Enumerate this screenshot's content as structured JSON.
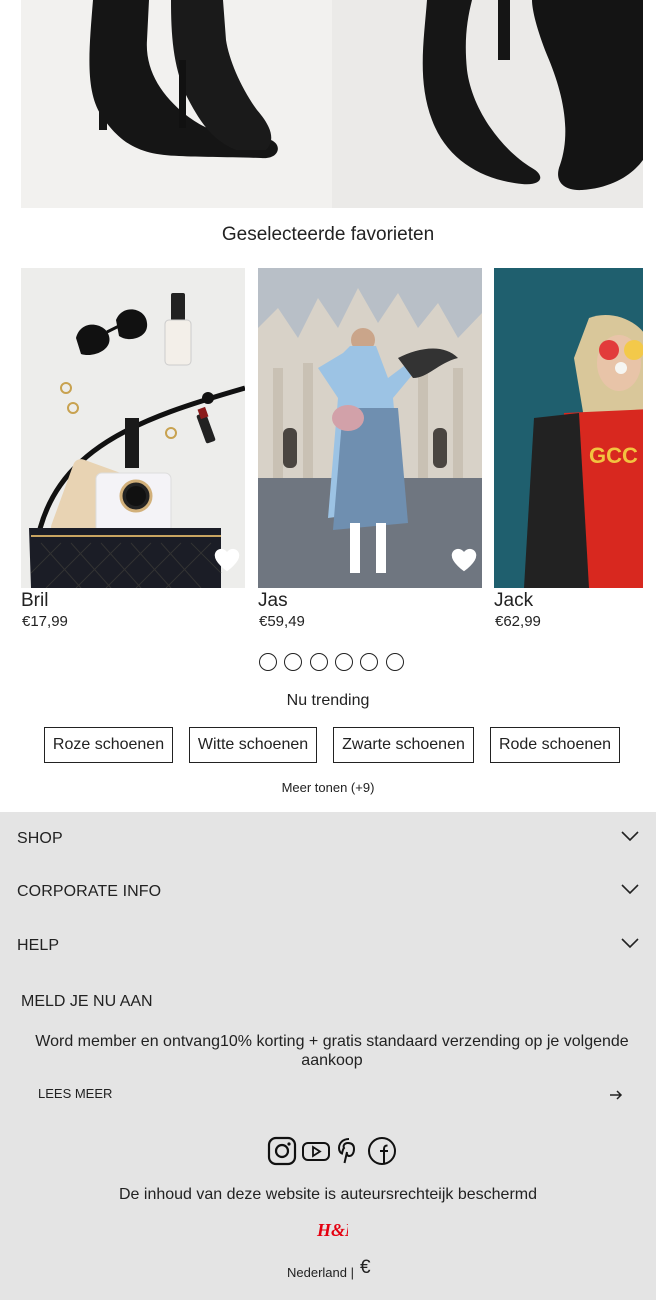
{
  "favorites": {
    "title": "Geselecteerde favorieten",
    "items": [
      {
        "name": "Bril",
        "price": "€17,99"
      },
      {
        "name": "Jas",
        "price": "€59,49"
      },
      {
        "name": "Jack",
        "price": "€62,99"
      }
    ],
    "dot_count": 6
  },
  "trending": {
    "title": "Nu trending",
    "chips": [
      "Roze schoenen",
      "Witte schoenen",
      "Zwarte schoenen",
      "Rode schoenen"
    ],
    "more_label": "Meer tonen (+9)"
  },
  "footer": {
    "sections": [
      "SHOP",
      "CORPORATE INFO",
      "HELP"
    ],
    "newsletter": {
      "title": "MELD JE NU AAN",
      "text": "Word member en ontvang10% korting + gratis standaard verzending op je volgende aankoop",
      "cta": "LEES MEER"
    },
    "social_icons": [
      "instagram-icon",
      "youtube-icon",
      "pinterest-icon",
      "facebook-icon"
    ],
    "copyright": "De inhoud van deze website is auteursrechteijk beschermd",
    "logo_text": "H&M",
    "locale": "Nederland |",
    "currency_symbol": "€"
  },
  "colors": {
    "footer_bg": "#e4e4e4",
    "brand_red": "#e50010",
    "text": "#222222"
  }
}
